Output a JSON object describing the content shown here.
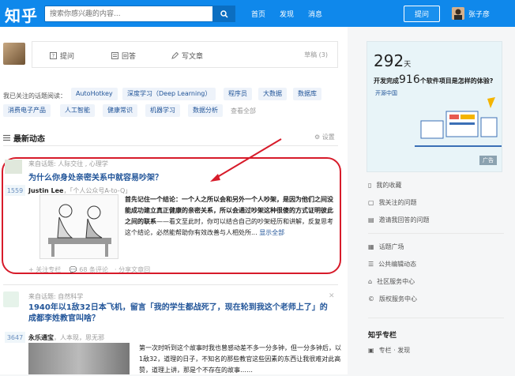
{
  "header": {
    "logo": "知乎",
    "search_placeholder": "搜索你感兴趣的内容...",
    "nav": [
      "首页",
      "发现",
      "消息"
    ],
    "ask_label": "提问",
    "username": "张子彦"
  },
  "composer": {
    "ask": "提问",
    "answer": "回答",
    "write": "写文章",
    "drafts": "草稿 (3)"
  },
  "topics": {
    "label": "我已关注的话题阅读：",
    "chips": [
      "AutoHotkey",
      "深度学习（Deep Learning）",
      "程序员",
      "大数据",
      "数据库",
      "消费电子产品",
      "人工智能",
      "健康常识",
      "机器学习",
      "数据分析"
    ],
    "view_all": "查看全部"
  },
  "feed": {
    "title": "最新动态",
    "settings": "设置",
    "items": [
      {
        "meta": "来自话题: 人际交往 , 心理学",
        "title": "为什么你身处亲密关系中就容易吵架？",
        "votes": "1559",
        "author": "Justin Lee",
        "author_desc": "，「个人公众号A-to-Q」",
        "excerpt_bold": "首先记住一个结论：一个人之所以会和另外一个人吵架，是因为他们之间没能成功建立真正健康的亲密关系，所以会通过吵架这种很傻的方式证明彼此之间的联系",
        "excerpt": "——看文至此时，你可以结合自己的吵架经历和讲解，反复思考这个结论，必然能帮助你有效改善与人相处所...",
        "more": "显示全部",
        "actions": "+ 关注专栏　 💬 68 条评论　· 分享文章回"
      },
      {
        "meta": "来自话题: 自然科学",
        "title": "1940年以1敌32日本飞机，留言「我的学生都战死了，现在轮到我这个老师上了」的成都李姓教官叫啥？",
        "votes": "3647",
        "author": "永乐通宝",
        "author_desc": "，人本现，思无邪",
        "excerpt": "第一次时听到这个故事时我也曾感动差不多一分多钟，但一分多钟后，以1敌32，道理的日子，不知名的那些教官这些因素的东西让我很难对此高赞，道理上讲，那是个不存在的故事……"
      }
    ]
  },
  "sidebar": {
    "ad": {
      "num": "292",
      "num_unit": "天",
      "line_a": "开发完成",
      "line_big": "916",
      "line_b": "个软件项目是怎样的体验?",
      "brand": "开源中国",
      "tag": "广告"
    },
    "links_a": [
      "我的收藏",
      "我关注的问题",
      "邀请我回答的问题"
    ],
    "links_b": [
      "话题广场",
      "公共编辑动态",
      "社区服务中心",
      "版权服务中心"
    ],
    "column_title": "知乎专栏",
    "column_item": "专栏 · 发现"
  }
}
